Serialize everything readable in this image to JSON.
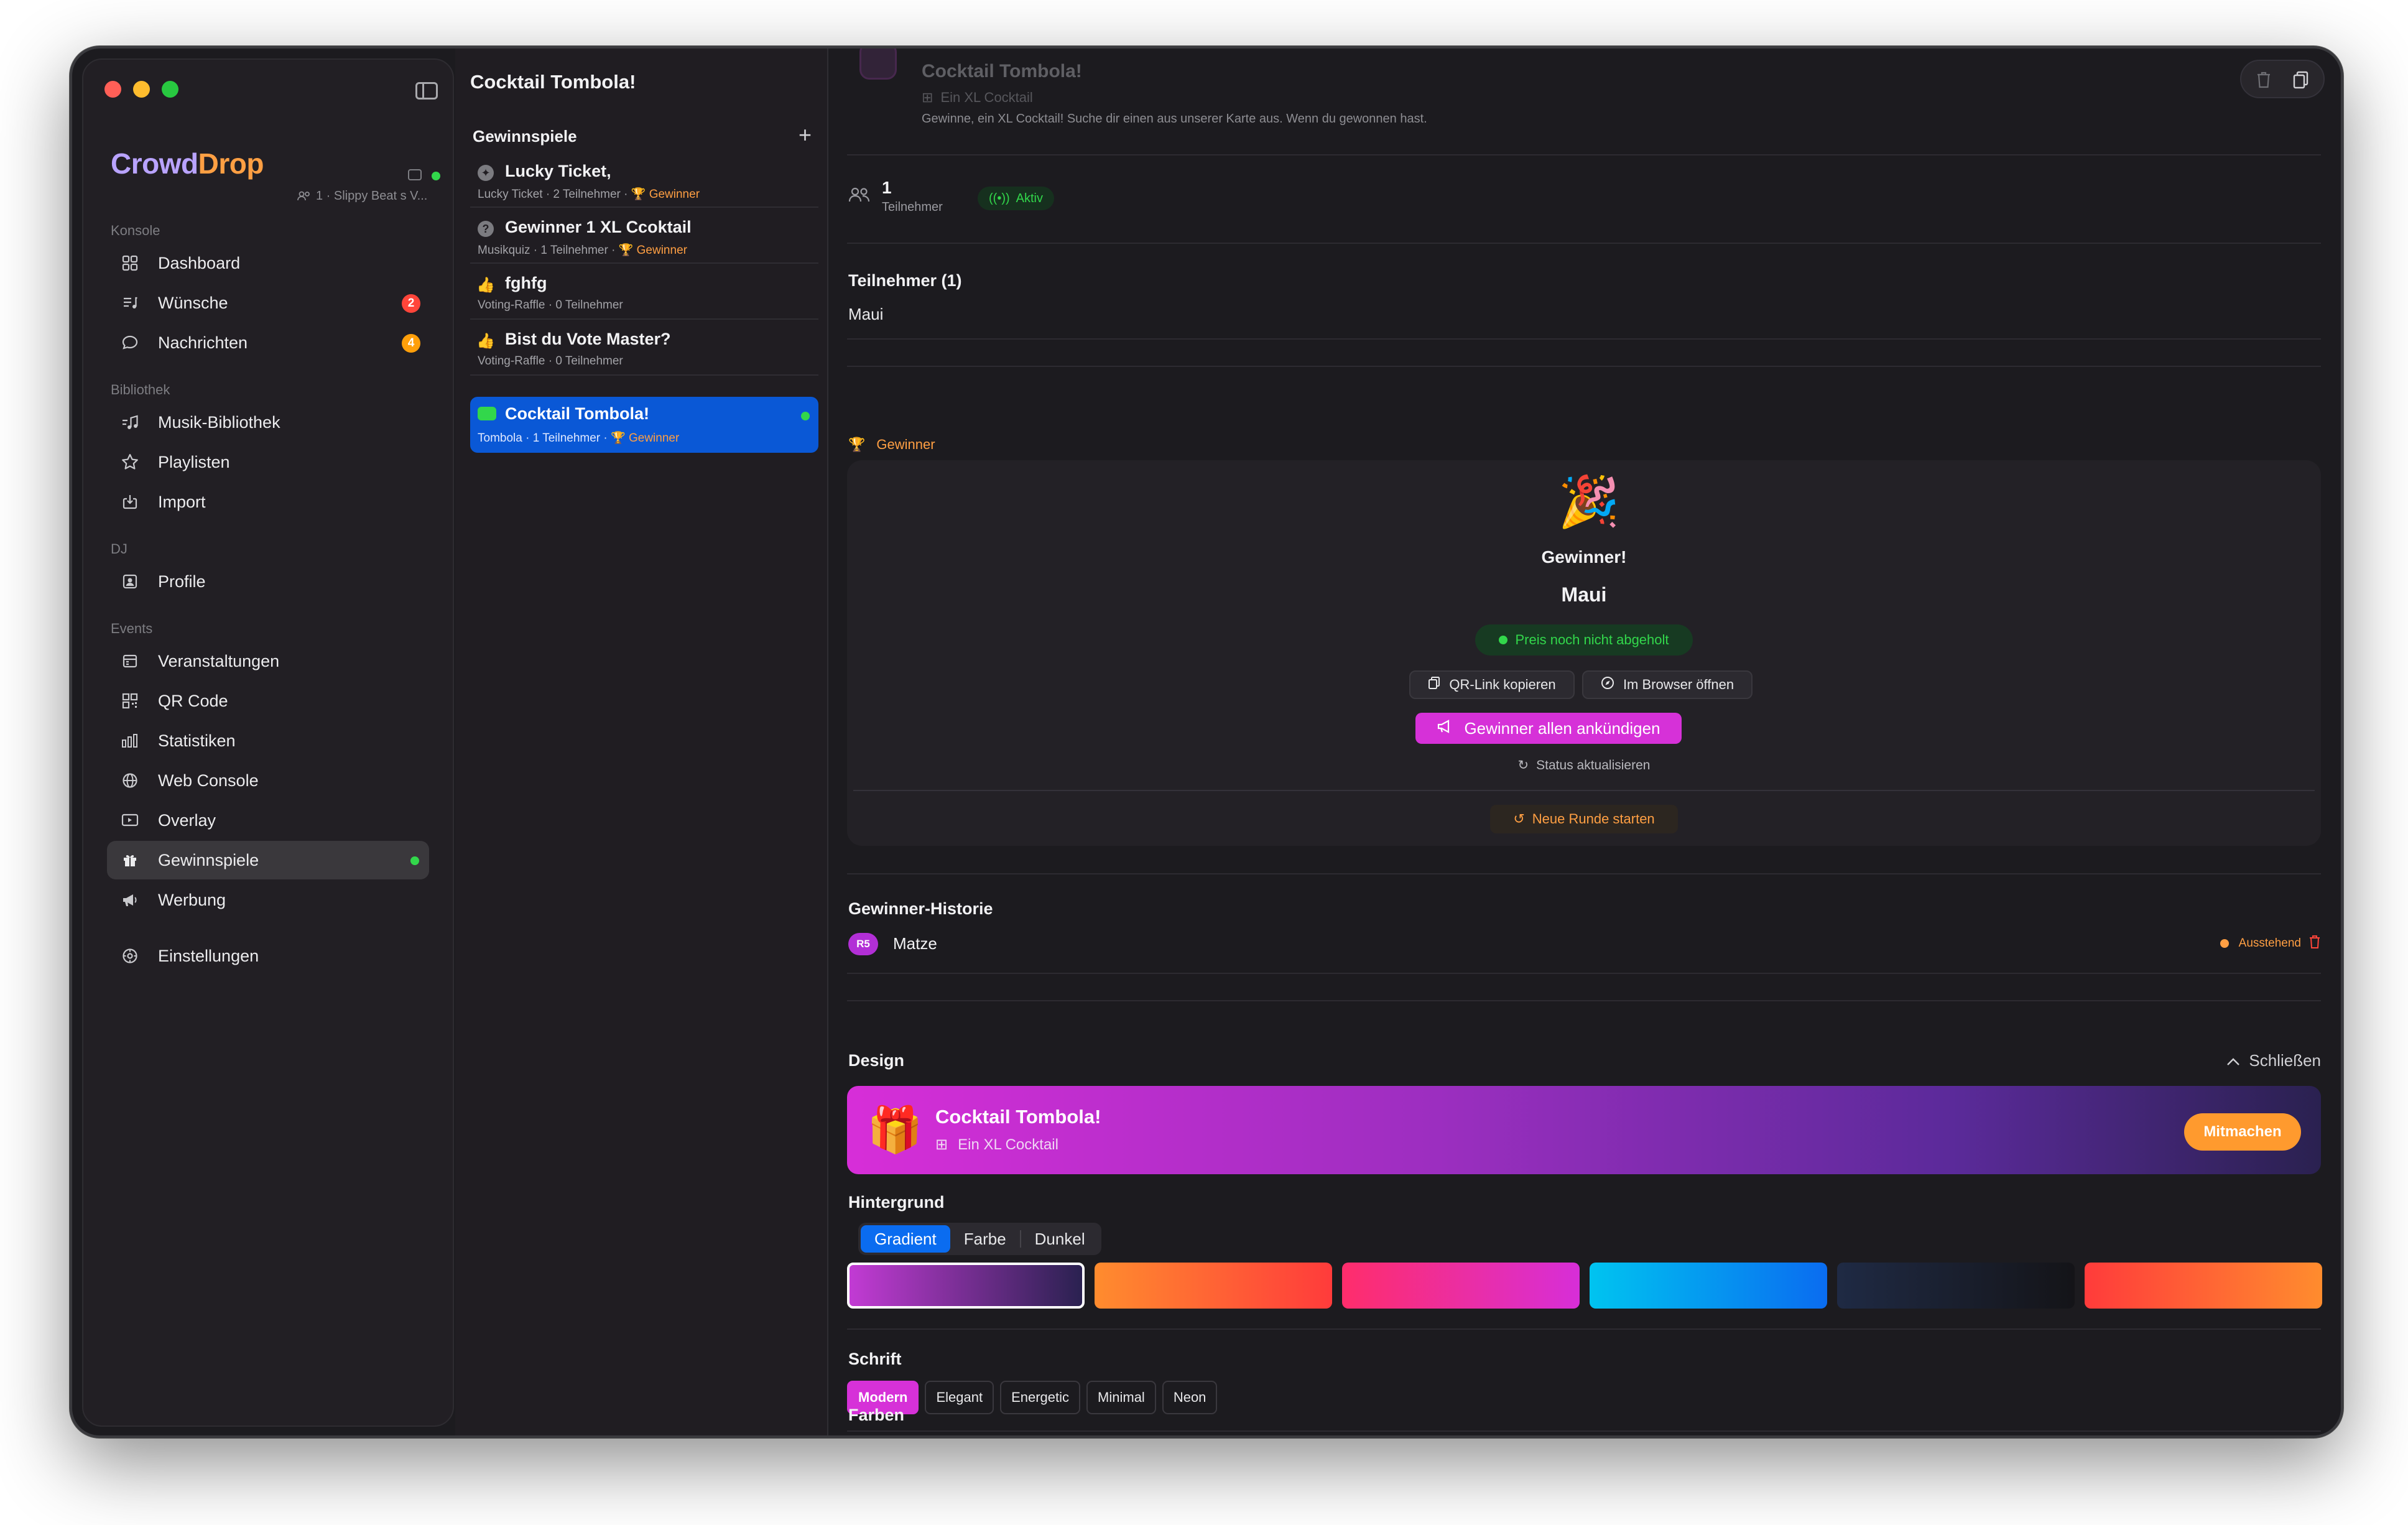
{
  "sidebar": {
    "brand_crowd": "Crowd",
    "brand_drop": "Drop",
    "brand_sub": "1 · Slippy  Beat s V...",
    "sections": {
      "konsole": "Konsole",
      "bibliothek": "Bibliothek",
      "dj": "DJ",
      "events": "Events"
    },
    "items": {
      "dashboard": "Dashboard",
      "wuensche": "Wünsche",
      "wuensche_badge": "2",
      "nachrichten": "Nachrichten",
      "nachrichten_badge": "4",
      "musik": "Musik-Bibliothek",
      "playlisten": "Playlisten",
      "import": "Import",
      "profile": "Profile",
      "veranstaltungen": "Veranstaltungen",
      "qrcode": "QR Code",
      "statistiken": "Statistiken",
      "webconsole": "Web Console",
      "overlay": "Overlay",
      "gewinnspiele": "Gewinnspiele",
      "werbung": "Werbung",
      "einstellungen": "Einstellungen"
    }
  },
  "list": {
    "title": "Cocktail Tombola!",
    "section": "Gewinnspiele",
    "games": [
      {
        "name": "Lucky Ticket,",
        "meta": "Lucky Ticket · 2 Teilnehmer ·",
        "winner": "Gewinner",
        "icon": "ticket-icon"
      },
      {
        "name": "Gewinner 1 XL Ccoktail",
        "meta": "Musikquiz · 1 Teilnehmer ·",
        "winner": "Gewinner",
        "icon": "question-icon"
      },
      {
        "name": "fghfg",
        "meta": "Voting-Raffle · 0 Teilnehmer",
        "winner": "",
        "icon": "thumbs-up-icon"
      },
      {
        "name": "Bist du Vote Master?",
        "meta": "Voting-Raffle · 0 Teilnehmer",
        "winner": "",
        "icon": "thumbs-up-icon"
      },
      {
        "name": "Cocktail Tombola!",
        "meta": "Tombola · 1 Teilnehmer ·",
        "winner": "Gewinner",
        "icon": "ticket-icon"
      }
    ]
  },
  "main": {
    "header_title": "Cocktail Tombola!",
    "header_prize": "Ein XL Cocktail",
    "header_desc": "Gewinne, ein XL Cocktail! Suche dir einen aus unserer Karte aus. Wenn du gewonnen hast.",
    "participants_count": "1",
    "participants_label": "Teilnehmer",
    "status_active": "Aktiv",
    "participants_heading": "Teilnehmer (1)",
    "participant_name": "Maui",
    "winner_label": "Gewinner",
    "winner_card": {
      "emoji": "🎉",
      "title": "Gewinner!",
      "name": "Maui",
      "pickup_status": "Preis noch nicht abgeholt",
      "qr_copy": "QR-Link kopieren",
      "open_browser": "Im Browser öffnen",
      "announce": "Gewinner allen ankündigen",
      "refresh": "Status aktualisieren",
      "new_round": "Neue Runde starten"
    },
    "history": {
      "heading": "Gewinner-Historie",
      "rows": [
        {
          "avatar": "R5",
          "name": "Matze",
          "status": "Ausstehend"
        }
      ]
    },
    "design": {
      "heading": "Design",
      "close": "Schließen",
      "banner_title": "Cocktail Tombola!",
      "banner_sub": "Ein XL Cocktail",
      "banner_join": "Mitmachen",
      "background_heading": "Hintergrund",
      "background_tabs": [
        "Gradient",
        "Farbe",
        "Dunkel"
      ],
      "background_selected": "Gradient",
      "swatches": [
        [
          "#c23bd4",
          "#2a2150"
        ],
        [
          "#ff8c2e",
          "#ff3b3b"
        ],
        [
          "#ff2d6b",
          "#d72ed8"
        ],
        [
          "#00c4f0",
          "#0a6cf0"
        ],
        [
          "#1f2a44",
          "#141418"
        ],
        [
          "#ff3b3b",
          "#ff8c2e"
        ]
      ],
      "font_heading": "Schrift",
      "fonts": [
        "Modern",
        "Elegant",
        "Energetic",
        "Minimal",
        "Neon"
      ],
      "font_selected": "Modern",
      "colors_heading": "Farben"
    }
  },
  "colors": {
    "accent_blue": "#0a58d6",
    "accent_magenta": "#d631d8",
    "accent_orange": "#ff9f43",
    "success_green": "#32d74b",
    "badge_red": "#ff453a",
    "badge_orange": "#ff9f0a"
  }
}
